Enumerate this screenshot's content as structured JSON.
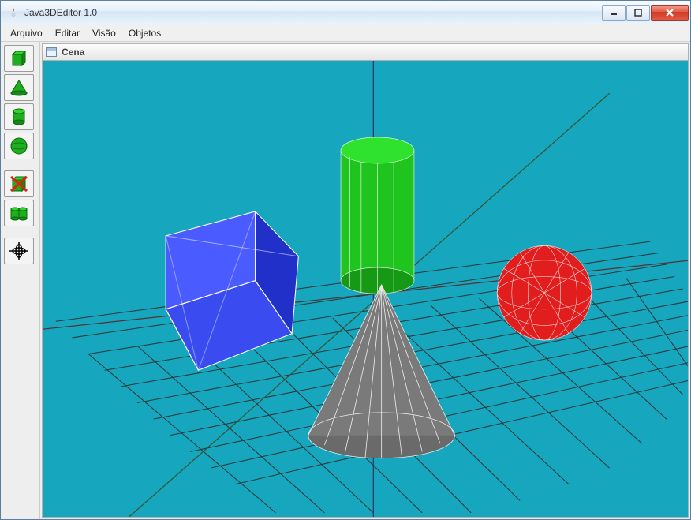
{
  "window": {
    "title": "Java3DEditor 1.0"
  },
  "menu": {
    "arquivo": "Arquivo",
    "editar": "Editar",
    "visao": "Visão",
    "objetos": "Objetos"
  },
  "panel": {
    "title": "Cena"
  },
  "colors": {
    "viewport_bg": "#16a6bd",
    "cube": "#2b3eea",
    "cylinder": "#1fc41f",
    "sphere": "#e21d1d",
    "cone": "#7a7a7a",
    "wire": "#ffffff",
    "grid": "#2b2b2b",
    "axis_x": "#8a2b2b",
    "axis_y": "#2b8a2b",
    "axis_z": "#2b2b8a",
    "tool_green": "#1fae1f"
  },
  "scene": {
    "objects": [
      {
        "type": "cube",
        "color": "blue"
      },
      {
        "type": "cylinder",
        "color": "green"
      },
      {
        "type": "sphere",
        "color": "red"
      },
      {
        "type": "cone",
        "color": "gray"
      }
    ]
  }
}
